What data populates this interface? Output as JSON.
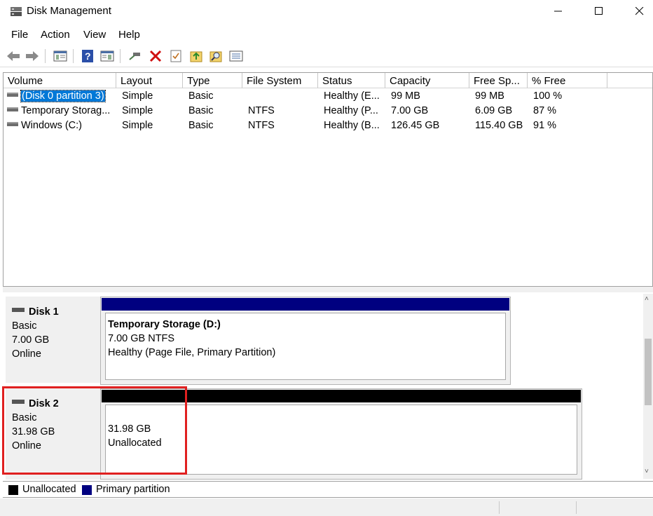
{
  "window": {
    "title": "Disk Management",
    "icon": "disk-management-icon",
    "minimize_glyph": "—",
    "maximize_glyph": "☐",
    "close_glyph": "✕"
  },
  "menu": {
    "items": [
      {
        "label": "File"
      },
      {
        "label": "Action"
      },
      {
        "label": "View"
      },
      {
        "label": "Help"
      }
    ]
  },
  "toolbar": {
    "icons": [
      "back-arrow-icon",
      "forward-arrow-icon",
      "console-tree-icon",
      "help-icon",
      "details-icon",
      "connect-icon",
      "delete-icon",
      "properties-icon",
      "import-icon",
      "search-icon",
      "list-view-icon"
    ]
  },
  "volume_table": {
    "columns": [
      "Volume",
      "Layout",
      "Type",
      "File System",
      "Status",
      "Capacity",
      "Free Sp...",
      "% Free"
    ],
    "rows": [
      {
        "volume": "(Disk 0 partition 3)",
        "layout": "Simple",
        "type": "Basic",
        "fs": "",
        "status": "Healthy (E...",
        "capacity": "99 MB",
        "free": "99 MB",
        "pct": "100 %",
        "selected": true
      },
      {
        "volume": "Temporary Storag...",
        "layout": "Simple",
        "type": "Basic",
        "fs": "NTFS",
        "status": "Healthy (P...",
        "capacity": "7.00 GB",
        "free": "6.09 GB",
        "pct": "87 %",
        "selected": false
      },
      {
        "volume": "Windows (C:)",
        "layout": "Simple",
        "type": "Basic",
        "fs": "NTFS",
        "status": "Healthy (B...",
        "capacity": "126.45 GB",
        "free": "115.40 GB",
        "pct": "91 %",
        "selected": false
      }
    ]
  },
  "disks": [
    {
      "name": "Disk 1",
      "type": "Basic",
      "size": "7.00 GB",
      "state": "Online",
      "partition": {
        "title": "Temporary Storage  (D:)",
        "line2": "7.00 GB NTFS",
        "line3": "Healthy (Page File, Primary Partition)",
        "bar_color": "#000080"
      }
    },
    {
      "name": "Disk 2",
      "type": "Basic",
      "size": "31.98 GB",
      "state": "Online",
      "partition": {
        "title": "",
        "line2": "31.98 GB",
        "line3": "Unallocated",
        "bar_color": "#000000"
      }
    }
  ],
  "legend": [
    {
      "label": "Unallocated",
      "color": "#000000"
    },
    {
      "label": "Primary partition",
      "color": "#000080"
    }
  ],
  "colors": {
    "selection": "#0078d7",
    "highlight": "#e02020"
  }
}
